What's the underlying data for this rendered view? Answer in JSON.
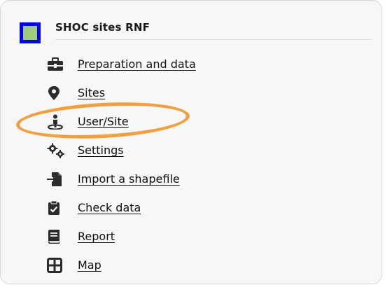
{
  "header": {
    "title": "SHOC sites RNF",
    "logo_border_color": "#0000ee",
    "logo_fill_color": "#9ccc7c"
  },
  "highlight": {
    "color": "#f0a040",
    "target": "User/Site"
  },
  "menu": {
    "items": [
      {
        "label": "Preparation and data",
        "icon": "toolbox-icon"
      },
      {
        "label": "Sites",
        "icon": "map-marker-icon"
      },
      {
        "label": "User/Site",
        "icon": "user-location-icon"
      },
      {
        "label": "Settings",
        "icon": "gears-icon"
      },
      {
        "label": "Import a shapefile",
        "icon": "file-import-icon"
      },
      {
        "label": "Check data",
        "icon": "clipboard-check-icon"
      },
      {
        "label": "Report",
        "icon": "book-icon"
      },
      {
        "label": "Map",
        "icon": "grid-map-icon"
      }
    ]
  }
}
